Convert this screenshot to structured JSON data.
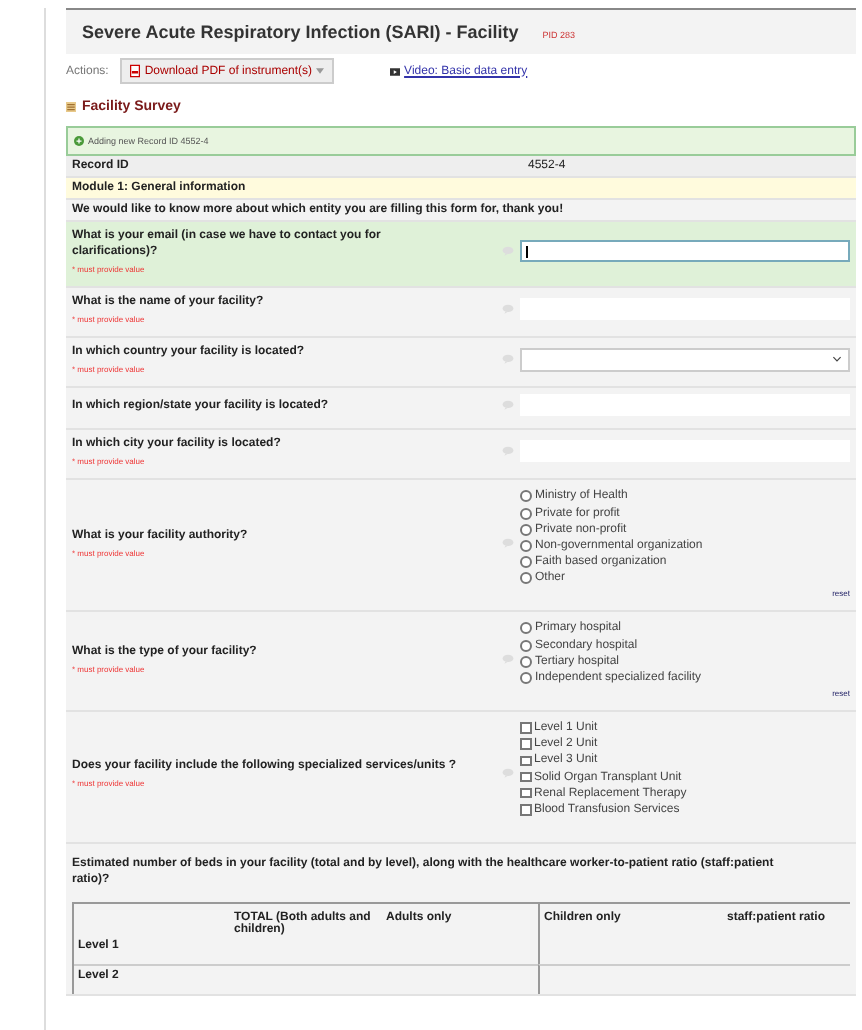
{
  "title": "Severe Acute Respiratory Infection (SARI) - Facility",
  "title_badge": "PID 283",
  "actions": {
    "label": "Actions:",
    "download": "Download PDF of instrument(s)",
    "video_link": "Video: Basic data entry"
  },
  "form_title": "Facility Survey",
  "notice": "Adding new Record ID 4552-4",
  "record": {
    "label": "Record ID",
    "value": "4552-4"
  },
  "section": "Module 1: General information",
  "intro": "We would like to know more about which entity you are filling this form for, thank you!",
  "questions": [
    {
      "kind": "text",
      "label": "What is your email (in case we have to contact you for clarifications)?",
      "required": "* must provide value",
      "focused": true
    },
    {
      "kind": "text",
      "label": "What is the name of your facility?",
      "required": "* must provide value",
      "focused": false
    },
    {
      "kind": "select",
      "label": "In which country your facility is located?",
      "required": "* must provide value",
      "focused": false
    },
    {
      "kind": "text",
      "label": "In which region/state your facility is located?",
      "focused": false
    },
    {
      "kind": "text",
      "label": "In which city your facility is located?",
      "required": "* must provide value",
      "focused": false
    },
    {
      "kind": "radio",
      "label": "What is your facility authority?",
      "required": "* must provide value",
      "reset": "reset",
      "options": [
        {
          "label": "Ministry of Health",
          "selected": false
        },
        {
          "label": "Private for profit",
          "selected": false
        },
        {
          "label": "Private non-profit",
          "selected": false
        },
        {
          "label": "Non-governmental organization",
          "selected": false
        },
        {
          "label": "Faith based organization",
          "selected": false
        },
        {
          "label": "Other",
          "selected": false
        }
      ]
    },
    {
      "kind": "radio",
      "label": "What is the type of your facility?",
      "required": "* must provide value",
      "reset": "reset",
      "options": [
        {
          "label": "Primary hospital",
          "selected": false
        },
        {
          "label": "Secondary hospital",
          "selected": false
        },
        {
          "label": "Tertiary hospital",
          "selected": false
        },
        {
          "label": "Independent specialized facility",
          "selected": false
        }
      ]
    },
    {
      "kind": "checkbox",
      "label": "Does your facility include the following specialized services/units ?",
      "required": "* must provide value",
      "options": [
        {
          "label": "Level 1 Unit",
          "checked": false
        },
        {
          "label": "Level 2 Unit",
          "checked": false
        },
        {
          "label": "Level 3 Unit",
          "checked": false
        },
        {
          "label": "Solid Organ Transplant Unit",
          "checked": false
        },
        {
          "label": "Renal Replacement Therapy",
          "checked": false
        },
        {
          "label": "Blood Transfusion Services",
          "checked": false
        }
      ]
    }
  ],
  "beds_question": "Estimated number of beds in your facility (total and by level), along with the healthcare worker-to-patient ratio (staff:patient ratio)?",
  "beds_table": {
    "columns": [
      "TOTAL (Both adults and children)",
      "Adults only",
      "Children only",
      "staff:patient ratio"
    ],
    "rows": [
      "Level 1",
      "Level 2"
    ]
  }
}
